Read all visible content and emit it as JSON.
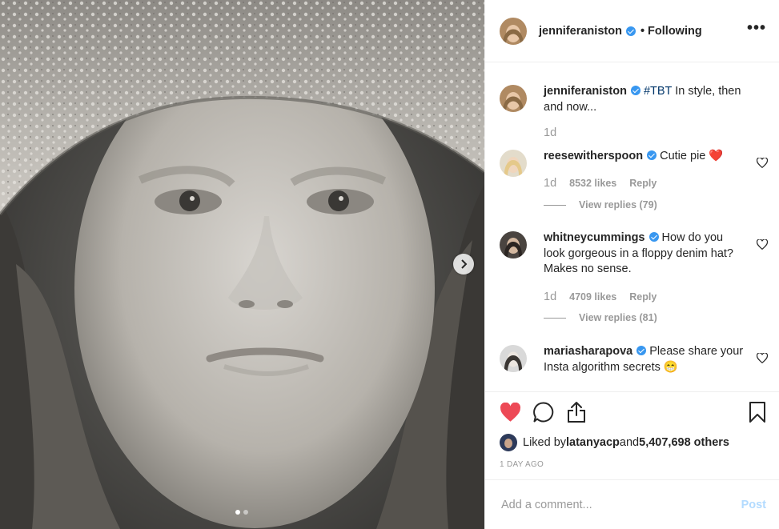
{
  "post": {
    "author": "jenniferaniston",
    "follow_status": "• Following",
    "more_label": "•••",
    "carousel": {
      "slides": 2,
      "active": 1
    }
  },
  "caption": {
    "username": "jenniferaniston",
    "hashtag": "#TBT",
    "text": " In style, then and now...",
    "age": "1d"
  },
  "comments": [
    {
      "username": "reesewitherspoon",
      "text": " Cutie pie ",
      "emoji": "❤️",
      "age": "1d",
      "likes": "8532 likes",
      "reply": "Reply",
      "view_replies": "View replies (79)"
    },
    {
      "username": "whitneycummings",
      "text": " How do you look gorgeous in a floppy denim hat? Makes no sense.",
      "age": "1d",
      "likes": "4709 likes",
      "reply": "Reply",
      "view_replies": "View replies (81)"
    },
    {
      "username": "mariasharapova",
      "text": " Please share your Insta algorithm secrets ",
      "emoji": "😁"
    }
  ],
  "likes_summary": {
    "prefix": "Liked by ",
    "user": "latanyacp",
    "middle": " and ",
    "count": "5,407,698 others"
  },
  "timestamp": "1 DAY AGO",
  "add_comment": {
    "placeholder": "Add a comment...",
    "post_label": "Post"
  },
  "colors": {
    "like_red": "#ed4956",
    "verified_blue": "#3897f0",
    "post_disabled": "#b3dbff"
  }
}
